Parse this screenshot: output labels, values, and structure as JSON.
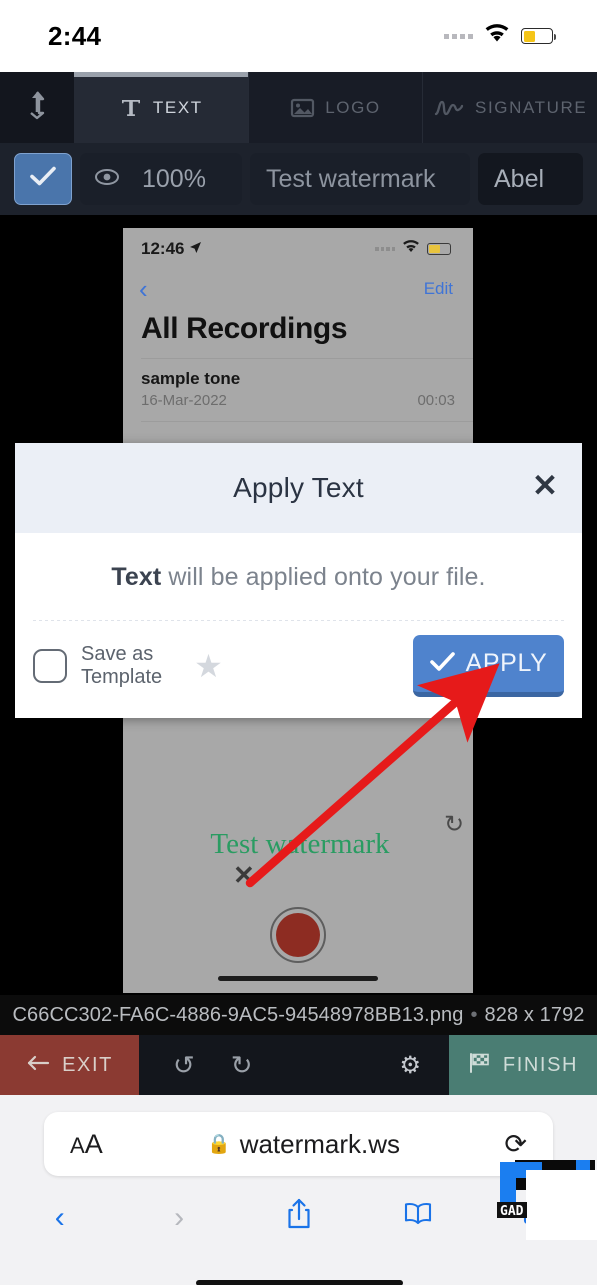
{
  "status_bar": {
    "time": "2:44",
    "wifi_icon": "wifi-icon",
    "battery_icon": "battery-icon",
    "battery_level": "42"
  },
  "editor": {
    "tabs": [
      {
        "id": "upload",
        "label": "",
        "icon": "upload-arrow-icon",
        "active": false
      },
      {
        "id": "text",
        "label": "TEXT",
        "icon": "text-T-icon",
        "active": true
      },
      {
        "id": "logo",
        "label": "LOGO",
        "icon": "image-logo-icon",
        "active": false
      },
      {
        "id": "signature",
        "label": "SIGNATURE",
        "icon": "signature-squiggle-icon",
        "active": false
      }
    ],
    "properties": {
      "enabled_checkbox": "checkmark-icon",
      "visibility_icon": "eye-icon",
      "opacity_value": "100%",
      "text_value": "Test watermark",
      "font_value": "Abel"
    },
    "filename": "C66CC302-FA6C-4886-9AC5-94548978BB13.png",
    "file_separator": "•",
    "file_dimensions": "828 x 1792",
    "bottom_toolbar": {
      "exit_label": "EXIT",
      "exit_icon": "arrow-left-icon",
      "undo_icon": "undo-icon",
      "redo_icon": "redo-icon",
      "settings_icon": "gear-icon",
      "finish_label": "FINISH",
      "finish_icon": "checkered-flag-icon"
    }
  },
  "preview": {
    "status_time": "12:46",
    "location_icon": "location-arrow-icon",
    "back_icon": "chevron-left-icon",
    "edit_label": "Edit",
    "title": "All Recordings",
    "rows": [
      {
        "name": "sample tone",
        "date": "16-Mar-2022",
        "duration": "00:03"
      }
    ],
    "watermark_text": "Test watermark",
    "watermark_color": "#2a9c62",
    "delete_handle_icon": "close-x-icon",
    "rotate_handle_icon": "rotate-icon",
    "record_button_icon": "record-button-icon"
  },
  "modal": {
    "title": "Apply Text",
    "close_icon": "close-x-icon",
    "message_bold": "Text",
    "message_rest": " will be applied onto your file.",
    "save_template_label_line1": "Save as",
    "save_template_label_line2": "Template",
    "star_icon": "star-icon",
    "apply_label": "APPLY",
    "apply_icon": "checkmark-icon",
    "apply_color": "#4f83cd"
  },
  "annotation": {
    "arrow_color": "#e61a1a",
    "arrow_type": "pointer-arrow"
  },
  "safari": {
    "text_size_label_small": "A",
    "text_size_label_large": "A",
    "lock_icon": "lock-icon",
    "url": "watermark.ws",
    "reload_icon": "reload-icon",
    "back_icon": "chevron-left-icon",
    "forward_icon": "chevron-right-icon",
    "share_icon": "share-icon",
    "bookmarks_icon": "book-icon",
    "tabs_icon": "tabs-icon",
    "corner_logo": "gad-logo-watermark"
  }
}
